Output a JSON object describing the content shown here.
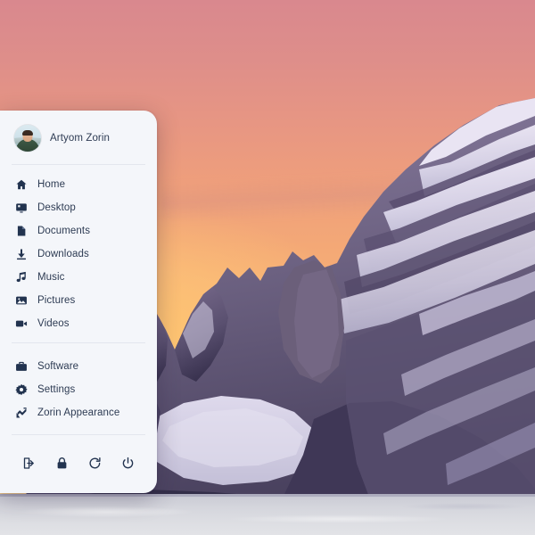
{
  "desktop": {
    "wallpaper_name": "mountain-sunset-wallpaper",
    "sky_top_color": "#d9888e",
    "sky_bottom_color": "#fbdb9f",
    "rock_color": "#6a5f7e",
    "snow_color": "#d8d4e6"
  },
  "menu": {
    "panel_name": "zorin-application-menu",
    "background_color": "#f4f6fa",
    "text_color": "#2d3b53",
    "user": {
      "name": "Artyom Zorin",
      "avatar_icon": "user-avatar-photo"
    },
    "places": [
      {
        "label": "Home",
        "icon": "home-icon"
      },
      {
        "label": "Desktop",
        "icon": "desktop-icon"
      },
      {
        "label": "Documents",
        "icon": "documents-icon"
      },
      {
        "label": "Downloads",
        "icon": "downloads-icon"
      },
      {
        "label": "Music",
        "icon": "music-icon"
      },
      {
        "label": "Pictures",
        "icon": "pictures-icon"
      },
      {
        "label": "Videos",
        "icon": "videos-icon"
      }
    ],
    "system": [
      {
        "label": "Software",
        "icon": "software-icon"
      },
      {
        "label": "Settings",
        "icon": "settings-gear-icon"
      },
      {
        "label": "Zorin Appearance",
        "icon": "appearance-brush-icon"
      }
    ],
    "actions": [
      {
        "name": "log-out-button",
        "icon": "log-out-icon"
      },
      {
        "name": "lock-button",
        "icon": "lock-icon"
      },
      {
        "name": "restart-button",
        "icon": "restart-icon"
      },
      {
        "name": "power-button",
        "icon": "power-icon"
      }
    ]
  }
}
